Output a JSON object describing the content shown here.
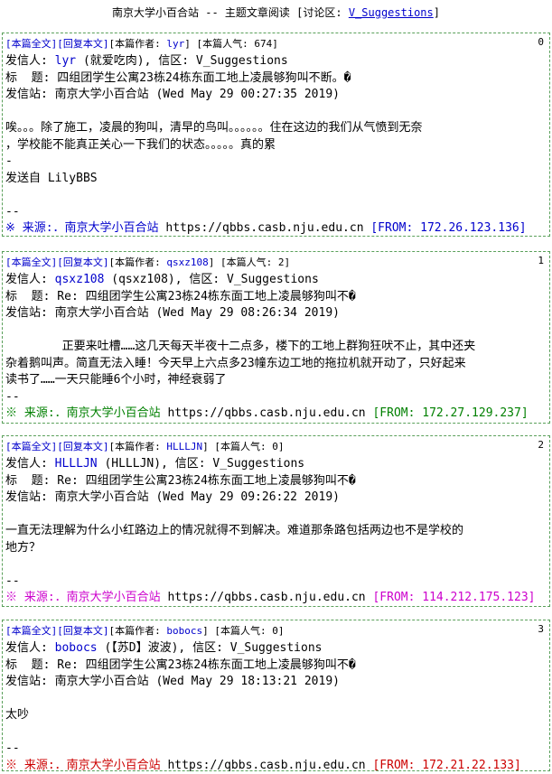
{
  "topbar": {
    "prefix": "南京大学小百合站 -- 主题文章阅读 [讨论区: ",
    "board": "V_Suggestions",
    "suffix": "]"
  },
  "posts": [
    {
      "link_full": "[本篇全文]",
      "link_reply": "[回复本文]",
      "author_label": "[本篇作者: ",
      "author": "lyr",
      "pop_label": "] [本篇人气: ",
      "popularity": "674",
      "pop_end": "]",
      "index": "0",
      "sender_label": "发信人: ",
      "sender_id": "lyr",
      "sender_rest": " (就爱吃肉), 信区: V_Suggestions",
      "title_line": "标  题: 四组团学生公寓23栋24栋东面工地上凌晨够狗叫不断。�",
      "station_line": "发信站: 南京大学小百合站 (Wed May 29 00:27:35 2019)",
      "content": "\n唉。。。除了施工，凌晨的狗叫，清早的鸟叫。。。。。。住在这边的我们从气愤到无奈\n，学校能不能真正关心一下我们的状态。。。。。真的累\n-\n发送自 LilyBBS\n\n--",
      "src_prefix": "※ 来源:．南京大学小百合站 ",
      "src_url": "https://qbbs.casb.nju.edu.cn",
      "src_from": " [FROM: 172.26.123.136]",
      "src_color": "blue"
    },
    {
      "link_full": "[本篇全文]",
      "link_reply": "[回复本文]",
      "author_label": "[本篇作者: ",
      "author": "qsxz108",
      "pop_label": "] [本篇人气: ",
      "popularity": "2",
      "pop_end": "]",
      "index": "1",
      "sender_label": "发信人: ",
      "sender_id": "qsxz108",
      "sender_rest": " (qsxz108), 信区: V_Suggestions",
      "title_line": "标  题: Re: 四组团学生公寓23栋24栋东面工地上凌晨够狗叫不�",
      "station_line": "发信站: 南京大学小百合站 (Wed May 29 08:26:34 2019)",
      "content": "\n        正要来吐槽……这几天每天半夜十二点多，楼下的工地上群狗狂吠不止，其中还夹\n杂着鹅叫声。简直无法入睡！今天早上六点多23幢东边工地的拖拉机就开动了，只好起来\n读书了……一天只能睡6个小时，神经衰弱了\n--",
      "src_prefix": "※ 来源:．南京大学小百合站 ",
      "src_url": "https://qbbs.casb.nju.edu.cn",
      "src_from": " [FROM: 172.27.129.237]",
      "src_color": "green"
    },
    {
      "link_full": "[本篇全文]",
      "link_reply": "[回复本文]",
      "author_label": "[本篇作者: ",
      "author": "HLLLJN",
      "pop_label": "] [本篇人气: ",
      "popularity": "0",
      "pop_end": "]",
      "index": "2",
      "sender_label": "发信人: ",
      "sender_id": "HLLLJN",
      "sender_rest": " (HLLLJN), 信区: V_Suggestions",
      "title_line": "标  题: Re: 四组团学生公寓23栋24栋东面工地上凌晨够狗叫不�",
      "station_line": "发信站: 南京大学小百合站 (Wed May 29 09:26:22 2019)",
      "content": "\n一直无法理解为什么小红路边上的情况就得不到解决。难道那条路包括两边也不是学校的\n地方？\n\n--",
      "src_prefix": "※ 来源:．南京大学小百合站 ",
      "src_url": "https://qbbs.casb.nju.edu.cn",
      "src_from": " [FROM: 114.212.175.123]",
      "src_color": "magenta"
    },
    {
      "link_full": "[本篇全文]",
      "link_reply": "[回复本文]",
      "author_label": "[本篇作者: ",
      "author": "bobocs",
      "pop_label": "] [本篇人气: ",
      "popularity": "0",
      "pop_end": "]",
      "index": "3",
      "sender_label": "发信人: ",
      "sender_id": "bobocs",
      "sender_rest": " (【苏D】波波), 信区: V_Suggestions",
      "title_line": "标  题: Re: 四组团学生公寓23栋24栋东面工地上凌晨够狗叫不�",
      "station_line": "发信站: 南京大学小百合站 (Wed May 29 18:13:21 2019)",
      "content": "\n太吵\n\n--",
      "src_prefix": "※ 来源:．南京大学小百合站 ",
      "src_url": "https://qbbs.casb.nju.edu.cn",
      "src_from": " [FROM: 172.21.22.133]",
      "src_color": "red"
    }
  ],
  "colors": {
    "link": "#0000cc",
    "border": "#5aa05a",
    "green": "#008000",
    "magenta": "#cc00cc",
    "red": "#cc0000"
  }
}
